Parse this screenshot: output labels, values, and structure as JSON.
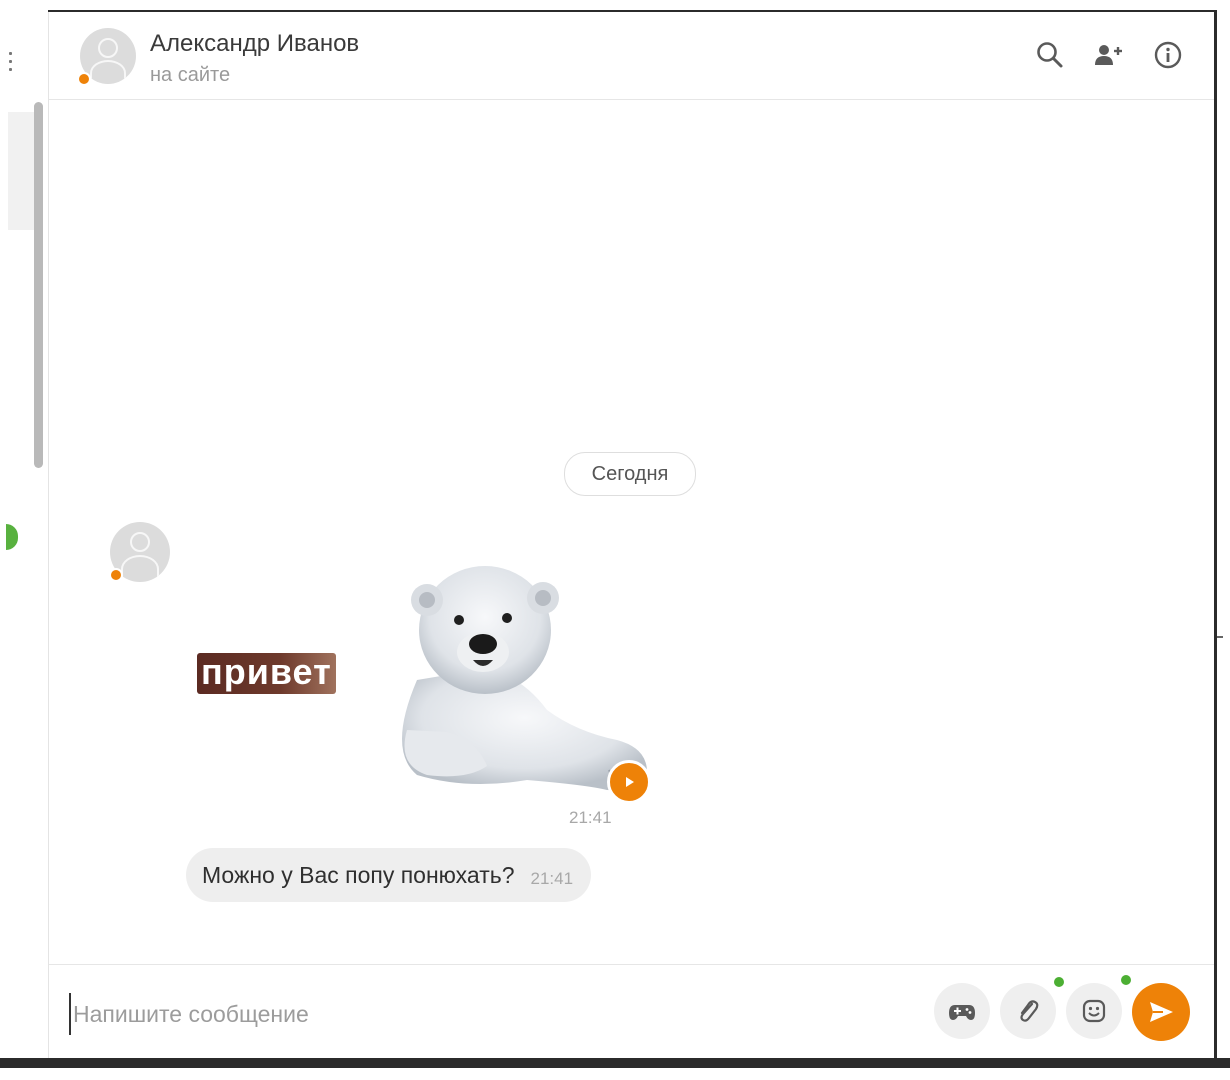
{
  "header": {
    "contact_name": "Александр Иванов",
    "contact_status": "на сайте",
    "icons": [
      "search-icon",
      "add-user-icon",
      "info-icon"
    ]
  },
  "chat": {
    "date_separator": "Сегодня",
    "messages": [
      {
        "type": "sticker",
        "sticker_text": "привет",
        "time": "21:41"
      },
      {
        "type": "text",
        "text": "Можно у Вас попу понюхать?",
        "time": "21:41"
      }
    ]
  },
  "composer": {
    "placeholder": "Напишите сообщение",
    "value": "",
    "buttons": [
      "gamepad-icon",
      "paperclip-icon",
      "emoji-icon",
      "send-icon"
    ]
  },
  "colors": {
    "accent": "#ee8208",
    "online_dot": "#4caf33",
    "bubble_bg": "#eeeeee"
  }
}
